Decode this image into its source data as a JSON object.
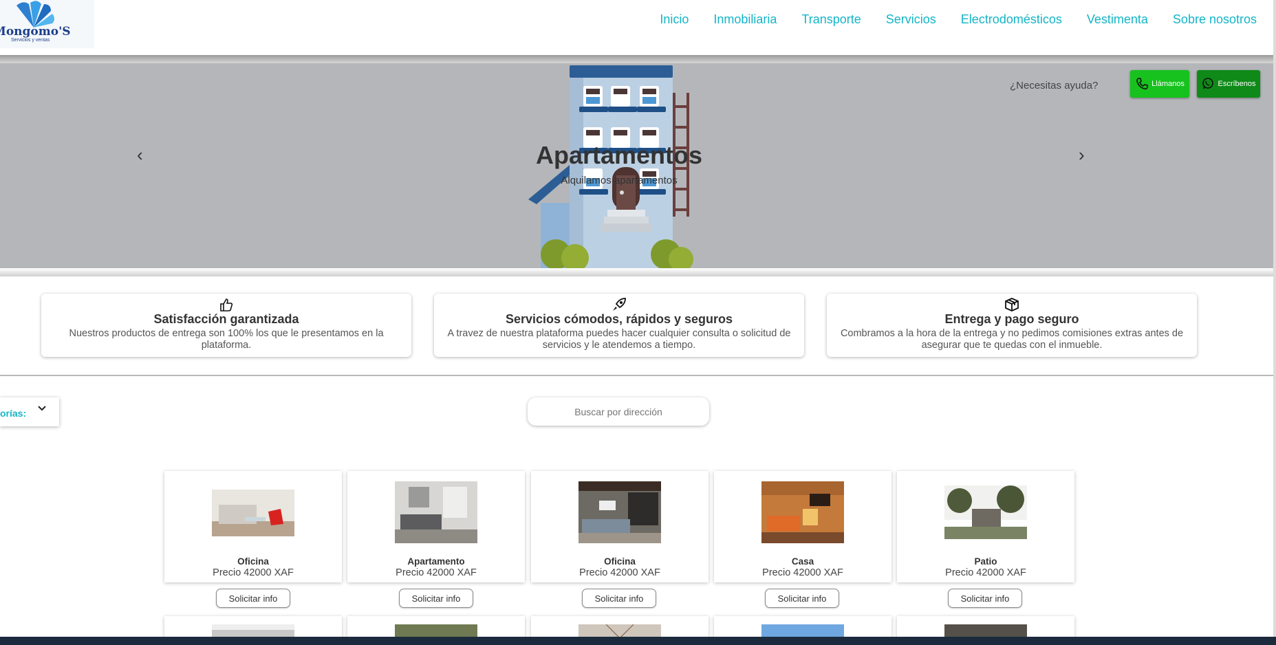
{
  "logo": {
    "text": "Mongomo'S",
    "subtitle": "Servicios y ventas"
  },
  "nav": [
    "Inicio",
    "Inmobiliaria",
    "Transporte",
    "Servicios",
    "Electrodomésticos",
    "Vestimenta",
    "Sobre nosotros"
  ],
  "hero": {
    "title": "Apartamentos",
    "subtitle": "Alquilamos apartamentos",
    "prev_icon": "‹",
    "next_icon": "›",
    "help_text": "¿Necesitas ayuda?",
    "call_label": "Llámanos",
    "write_label": "Escríbenos"
  },
  "features": [
    {
      "icon": "thumbs-up",
      "title": "Satisfacción garantizada",
      "text": "Nuestros productos de entrega son 100% los que le presentamos en la plataforma."
    },
    {
      "icon": "rocket",
      "title": "Servicios cómodos, rápidos y seguros",
      "text": "A travez de nuestra plataforma puedes hacer cualquier consulta o solicitud de servicios y le atendemos a tiempo."
    },
    {
      "icon": "box",
      "title": "Entrega y pago seguro",
      "text": "Combramos a la hora de la entrega y no pedimos comisiones extras antes de asegurar que te quedas con el inmueble."
    }
  ],
  "filter": {
    "category_label": "orías:",
    "search_placeholder": "Buscar por dirección"
  },
  "listings": [
    {
      "name": "Oficina",
      "price": "Precio 42000 XAF",
      "button": "Solicitar info"
    },
    {
      "name": "Apartamento",
      "price": "Precio 42000 XAF",
      "button": "Solicitar info"
    },
    {
      "name": "Oficina",
      "price": "Precio 42000 XAF",
      "button": "Solicitar info"
    },
    {
      "name": "Casa",
      "price": "Precio 42000 XAF",
      "button": "Solicitar info"
    },
    {
      "name": "Patio",
      "price": "Precio 42000 XAF",
      "button": "Solicitar info"
    }
  ],
  "colors": {
    "accent": "#14b5c7",
    "call_green": "#17c21e",
    "whatsapp_green": "#0f8a18",
    "hero_bg": "#b5b6ba"
  }
}
